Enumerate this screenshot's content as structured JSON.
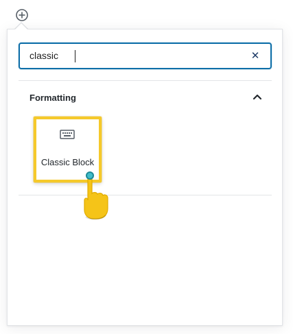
{
  "inserter": {
    "toggle_icon": "plus-circle-icon"
  },
  "search": {
    "value": "classic",
    "clear_icon": "close-icon",
    "clear_glyph": "✕"
  },
  "panel": {
    "title": "Formatting",
    "expanded": true,
    "chevron_icon": "chevron-up-icon"
  },
  "blocks": [
    {
      "label": "Classic Block",
      "icon": "keyboard-icon",
      "highlighted": true
    }
  ],
  "colors": {
    "focus_border": "#0e6ea8",
    "highlight": "#f5c92a",
    "cursor_dot": "#3fbcc9",
    "hand": "#f5c418"
  }
}
